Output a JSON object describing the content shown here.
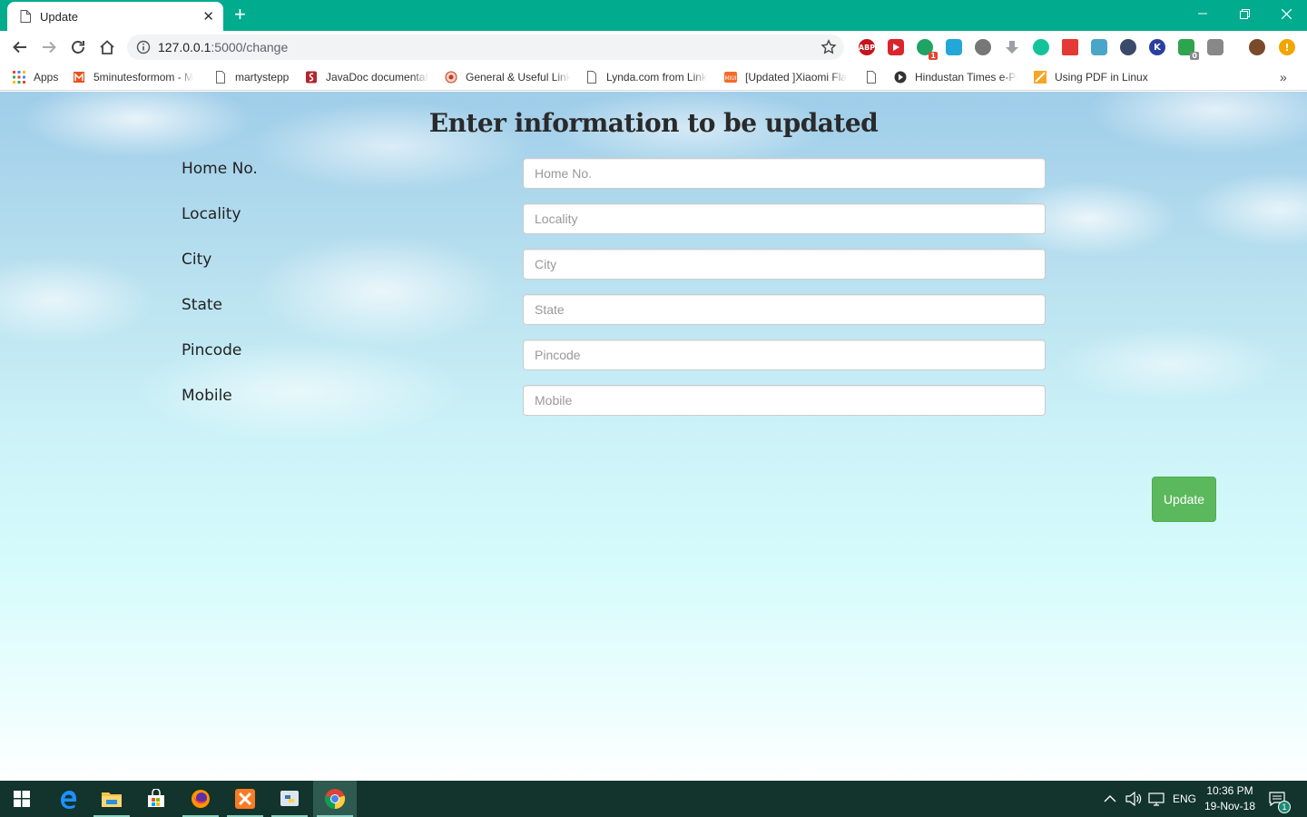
{
  "browser": {
    "tab_title": "Update",
    "new_tab": "+",
    "url_host": "127.0.0.1",
    "url_path": ":5000/change"
  },
  "bookmarks": [
    {
      "label": "Apps",
      "icon": "apps-grid-icon"
    },
    {
      "label": "5minutesformom - M",
      "icon": "5minutesformom-icon"
    },
    {
      "label": "martystepp",
      "icon": "page-icon"
    },
    {
      "label": "JavaDoc documentat",
      "icon": "javadoc-icon"
    },
    {
      "label": "General & Useful Link",
      "icon": "general-icon"
    },
    {
      "label": "Lynda.com from Link",
      "icon": "page-icon"
    },
    {
      "label": "[Updated ]Xiaomi Fla",
      "icon": "miui-icon"
    },
    {
      "label": "",
      "icon": "page-icon"
    },
    {
      "label": "Hindustan Times e-Pa",
      "icon": "hindustan-times-icon"
    },
    {
      "label": "Using PDF in Linux",
      "icon": "pdf-icon"
    }
  ],
  "extensions": {
    "abp": "ABP",
    "badge_1": "1",
    "badge_0": "0",
    "k": "K"
  },
  "page": {
    "title": "Enter information to be updated",
    "fields": [
      {
        "label": "Home No.",
        "placeholder": "Home No."
      },
      {
        "label": "Locality",
        "placeholder": "Locality"
      },
      {
        "label": "City",
        "placeholder": "City"
      },
      {
        "label": "State",
        "placeholder": "State"
      },
      {
        "label": "Pincode",
        "placeholder": "Pincode"
      },
      {
        "label": "Mobile",
        "placeholder": "Mobile"
      }
    ],
    "submit_label": "Update"
  },
  "taskbar": {
    "language": "ENG",
    "time": "10:36 PM",
    "date": "19-Nov-18",
    "notification_count": "1"
  },
  "colors": {
    "chrome_frame": "#00ab8e",
    "update_button": "#5cb85c",
    "taskbar": "#12342c"
  }
}
